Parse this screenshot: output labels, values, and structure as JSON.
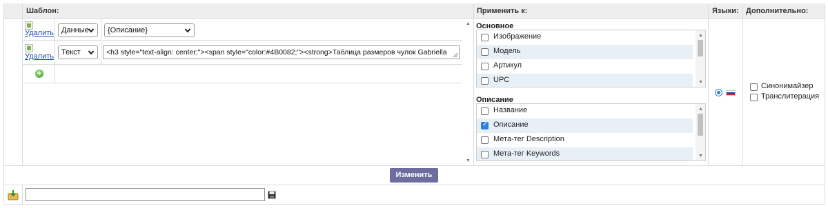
{
  "headers": {
    "template": "Шаблон:",
    "apply_to": "Применить к:",
    "languages": "Языки:",
    "extra": "Дополнительно:"
  },
  "template_rows": [
    {
      "delete_label": "Удалить",
      "type_value": "Данные",
      "field_value": "{Описание}"
    },
    {
      "delete_label": "Удалить",
      "type_value": "Текст",
      "text_value": "<h3 style=\"text-align: center;\"><span style=\"color:#4B0082;\"><strong>Таблица размеров чулок Gabriella"
    }
  ],
  "apply_groups": [
    {
      "title": "Основное",
      "items": [
        {
          "label": "Изображение",
          "checked": false
        },
        {
          "label": "Модель",
          "checked": false
        },
        {
          "label": "Артикул",
          "checked": false
        },
        {
          "label": "UPC",
          "checked": false
        }
      ]
    },
    {
      "title": "Описание",
      "items": [
        {
          "label": "Название",
          "checked": false
        },
        {
          "label": "Описание",
          "checked": true
        },
        {
          "label": "Мета-тег Description",
          "checked": false
        },
        {
          "label": "Мета-тег Keywords",
          "checked": false
        }
      ]
    }
  ],
  "languages": {
    "selected": "ru",
    "flag_colors": [
      "#ffffff",
      "#1c3fa8",
      "#d52b1e"
    ]
  },
  "extra_options": [
    {
      "label": "Синонимайзер",
      "checked": false
    },
    {
      "label": "Транслитерация",
      "checked": false
    }
  ],
  "submit_label": "Изменить",
  "bottom": {
    "input_value": ""
  },
  "icons": {
    "add": "add-circle-icon",
    "import": "import-download-icon",
    "save": "floppy-disk-icon"
  }
}
